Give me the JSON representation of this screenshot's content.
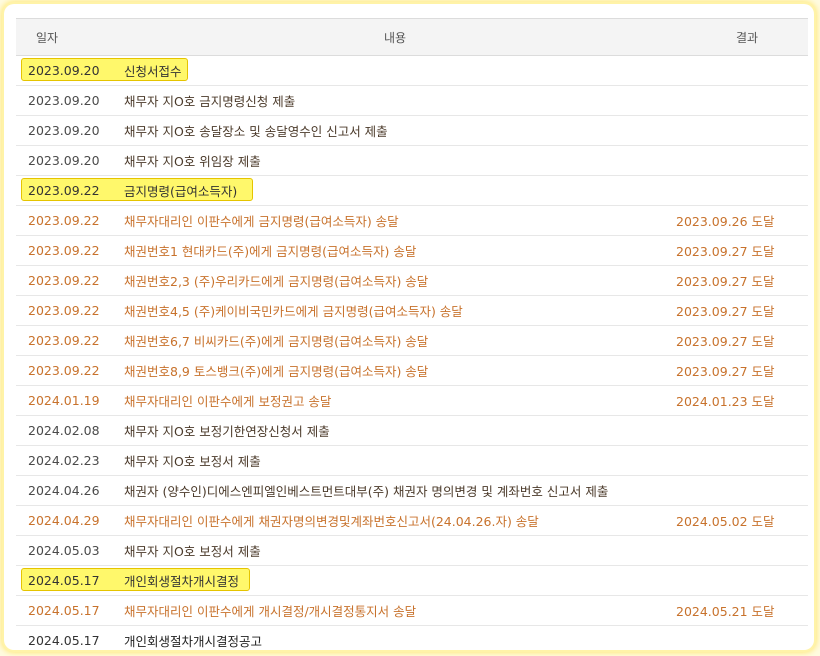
{
  "header": {
    "date": "일자",
    "content": "내용",
    "result": "결과"
  },
  "rows": [
    {
      "date": "2023.09.20",
      "content": "신청서접수",
      "result": "",
      "style": "hl",
      "hl_width": 167
    },
    {
      "date": "2023.09.20",
      "content": "채무자 지O호 금지명령신청 제출",
      "result": "",
      "style": "dark"
    },
    {
      "date": "2023.09.20",
      "content": "채무자 지O호 송달장소 및 송달영수인 신고서 제출",
      "result": "",
      "style": "dark"
    },
    {
      "date": "2023.09.20",
      "content": "채무자 지O호 위임장 제출",
      "result": "",
      "style": "dark"
    },
    {
      "date": "2023.09.22",
      "content": "금지명령(급여소득자)",
      "result": "",
      "style": "hl",
      "hl_width": 232
    },
    {
      "date": "2023.09.22",
      "content": "채무자대리인 이판수에게 금지명령(급여소득자) 송달",
      "result": "2023.09.26 도달",
      "style": "orange"
    },
    {
      "date": "2023.09.22",
      "content": "채권번호1 현대카드(주)에게 금지명령(급여소득자) 송달",
      "result": "2023.09.27 도달",
      "style": "orange"
    },
    {
      "date": "2023.09.22",
      "content": "채권번호2,3 (주)우리카드에게 금지명령(급여소득자) 송달",
      "result": "2023.09.27 도달",
      "style": "orange"
    },
    {
      "date": "2023.09.22",
      "content": "채권번호4,5 (주)케이비국민카드에게 금지명령(급여소득자) 송달",
      "result": "2023.09.27 도달",
      "style": "orange"
    },
    {
      "date": "2023.09.22",
      "content": "채권번호6,7 비씨카드(주)에게 금지명령(급여소득자) 송달",
      "result": "2023.09.27 도달",
      "style": "orange"
    },
    {
      "date": "2023.09.22",
      "content": "채권번호8,9 토스뱅크(주)에게 금지명령(급여소득자) 송달",
      "result": "2023.09.27 도달",
      "style": "orange"
    },
    {
      "date": "2024.01.19",
      "content": "채무자대리인 이판수에게 보정권고 송달",
      "result": "2024.01.23 도달",
      "style": "orange"
    },
    {
      "date": "2024.02.08",
      "content": "채무자 지O호 보정기한연장신청서 제출",
      "result": "",
      "style": "dark"
    },
    {
      "date": "2024.02.23",
      "content": "채무자 지O호 보정서 제출",
      "result": "",
      "style": "dark"
    },
    {
      "date": "2024.04.26",
      "content": "채권자 (양수인)디에스엔피엘인베스트먼트대부(주) 채권자 명의변경 및 계좌번호 신고서 제출",
      "result": "",
      "style": "dark"
    },
    {
      "date": "2024.04.29",
      "content": "채무자대리인 이판수에게 채권자명의변경및계좌번호신고서(24.04.26.자) 송달",
      "result": "2024.05.02 도달",
      "style": "orange"
    },
    {
      "date": "2024.05.03",
      "content": "채무자 지O호 보정서 제출",
      "result": "",
      "style": "dark"
    },
    {
      "date": "2024.05.17",
      "content": "개인회생절차개시결정",
      "result": "",
      "style": "hl",
      "hl_width": 229
    },
    {
      "date": "2024.05.17",
      "content": "채무자대리인 이판수에게 개시결정/개시결정통지서 송달",
      "result": "2024.05.21 도달",
      "style": "orange"
    },
    {
      "date": "2024.05.17",
      "content": "개인회생절차개시결정공고",
      "result": "",
      "style": "plain"
    }
  ]
}
